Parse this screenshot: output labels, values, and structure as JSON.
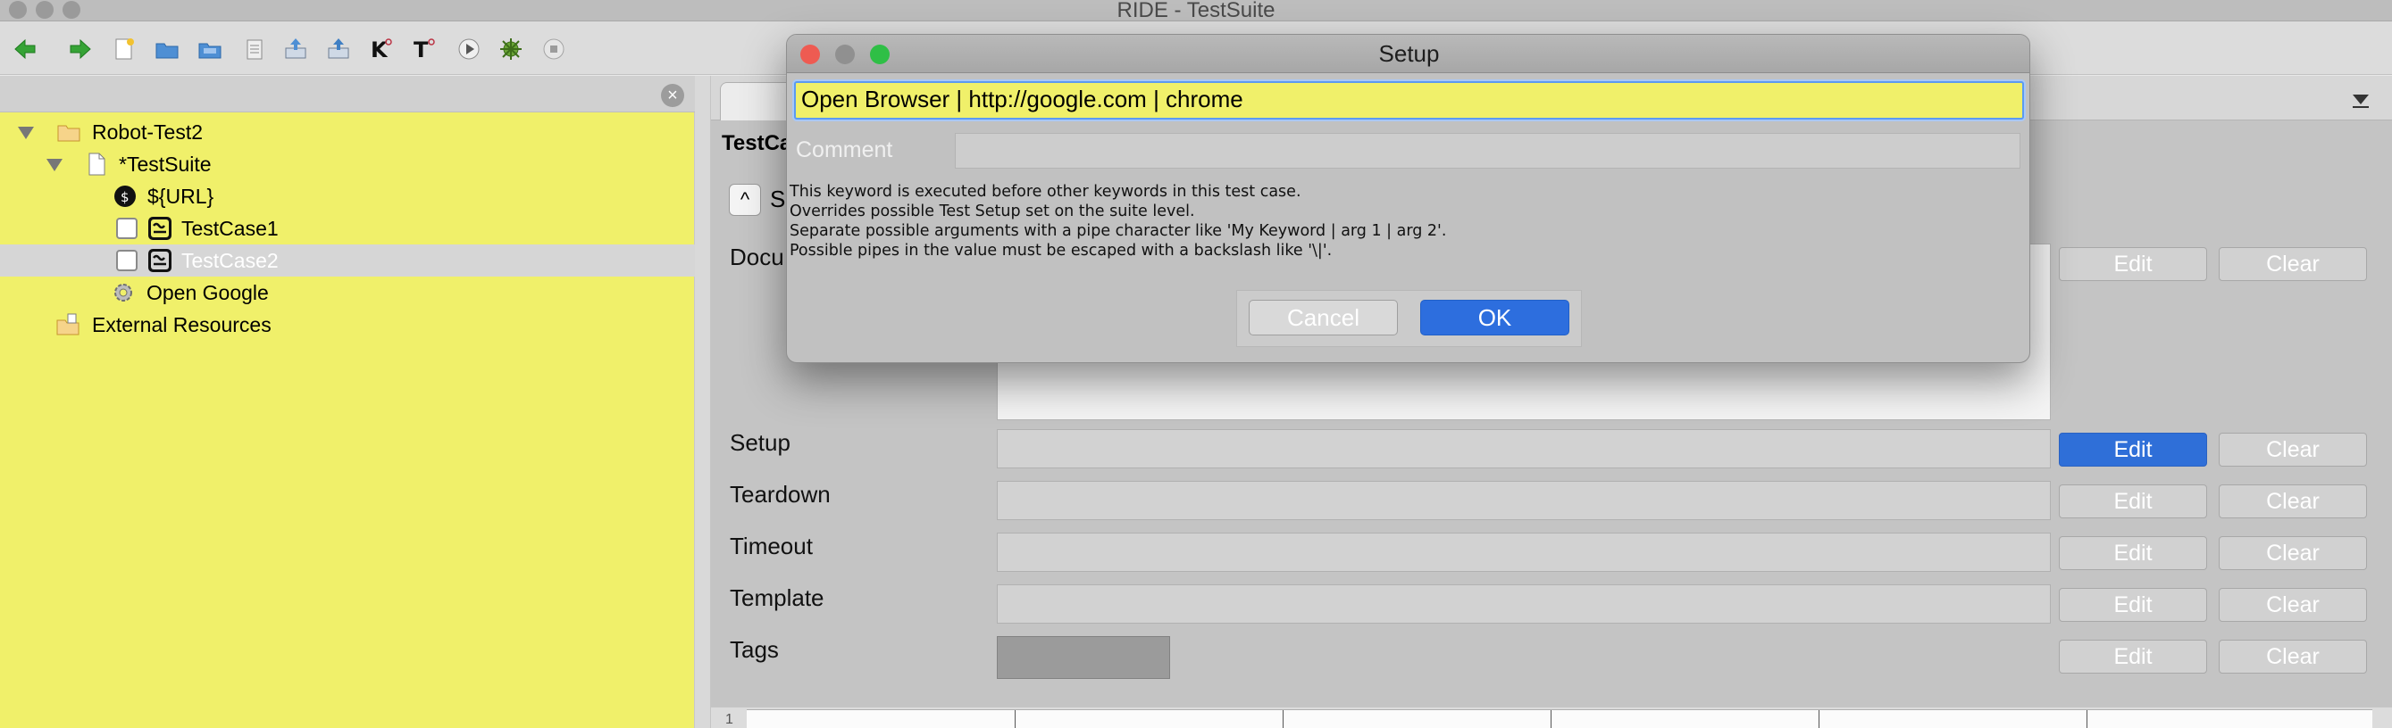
{
  "window": {
    "title": "RIDE - TestSuite"
  },
  "toolbar": {
    "buttons": [
      {
        "icon": "back-arrow-icon",
        "color": "#3aa63a"
      },
      {
        "icon": "forward-arrow-icon",
        "color": "#3aa63a"
      },
      {
        "icon": "new-project-icon"
      },
      {
        "icon": "open-folder-icon"
      },
      {
        "icon": "open-directory-icon"
      },
      {
        "icon": "save-icon"
      },
      {
        "icon": "save-all-icon"
      },
      {
        "icon": "import-resource-icon"
      },
      {
        "icon": "search-keywords-icon",
        "text": "K"
      },
      {
        "icon": "search-tests-icon",
        "text": "T"
      },
      {
        "icon": "run-icon"
      },
      {
        "icon": "debug-icon"
      },
      {
        "icon": "stop-icon"
      }
    ]
  },
  "tree": {
    "items": [
      {
        "label": "Robot-Test2",
        "icon": "folder-icon"
      },
      {
        "label": "*TestSuite",
        "icon": "file-icon"
      },
      {
        "label": "${URL}",
        "icon": "variable-icon"
      },
      {
        "label": "TestCase1",
        "icon": "testcase-icon"
      },
      {
        "label": "TestCase2",
        "icon": "testcase-icon",
        "selected": true
      },
      {
        "label": "Open Google",
        "icon": "keyword-gear-icon"
      },
      {
        "label": "External Resources",
        "icon": "external-resources-icon"
      }
    ]
  },
  "editor": {
    "heading": "TestCa",
    "settings_label": "S",
    "collapse_symbol": "^",
    "fields": {
      "documentation": "Docu",
      "setup": "Setup",
      "teardown": "Teardown",
      "timeout": "Timeout",
      "template": "Template",
      "tags": "Tags"
    },
    "edit_label": "Edit",
    "clear_label": "Clear",
    "grid_row_number": "1"
  },
  "dialog": {
    "title": "Setup",
    "value": "Open Browser | http://google.com | chrome",
    "comment_label": "Comment",
    "comment_value": "",
    "help_lines": [
      "This keyword is executed before other keywords in this test case.",
      "Overrides possible Test Setup set on the suite level.",
      "Separate possible arguments with a pipe character like 'My Keyword | arg 1 | arg 2'.",
      "Possible pipes in the value must be escaped with a backslash like '\\|'."
    ],
    "cancel_label": "Cancel",
    "ok_label": "OK",
    "traffic_light_colors": [
      "#ee5b52",
      "#909090",
      "#2fbf46"
    ]
  },
  "colors": {
    "tree_background": "#f0f06a",
    "primary_button": "#2f6fd8",
    "selected_row": "#d6d6d6"
  }
}
